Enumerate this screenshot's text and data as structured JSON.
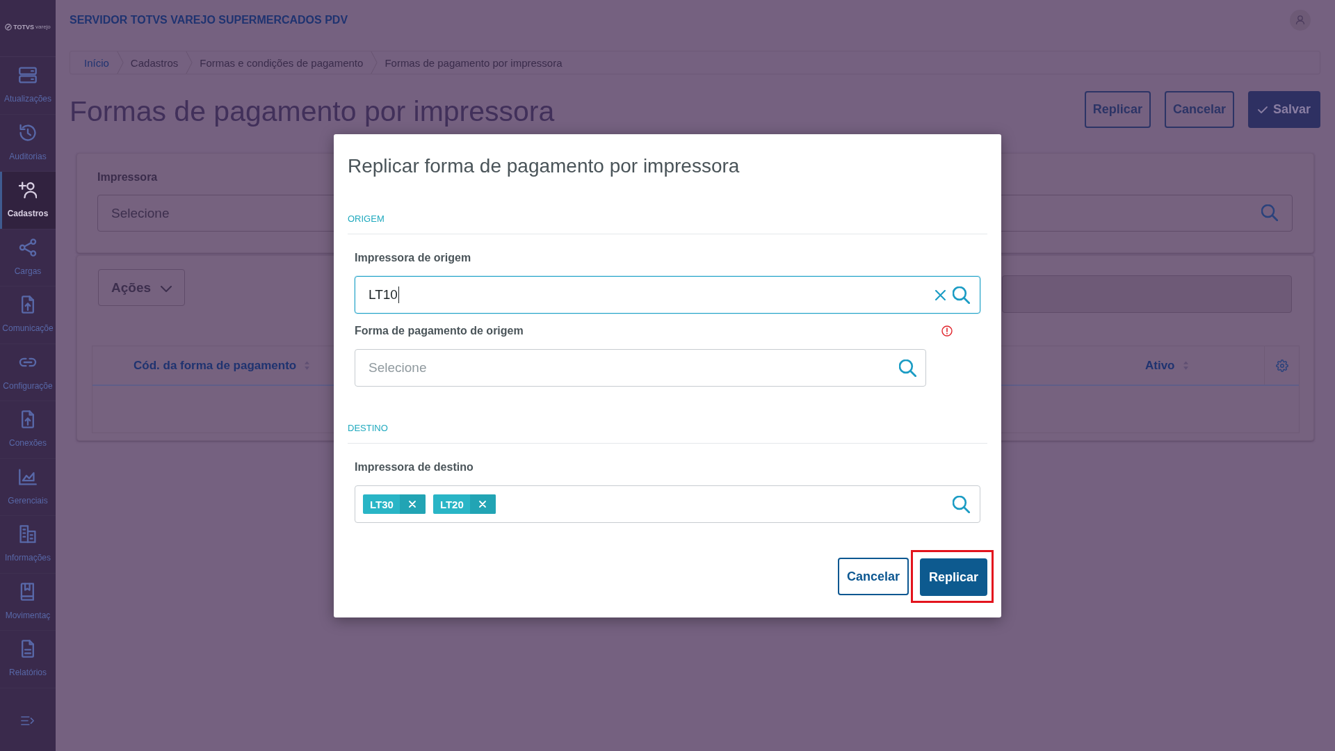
{
  "sidebar": {
    "logo": {
      "brand": "TOTVS",
      "product": "varejo"
    },
    "items": [
      {
        "label": "Atualizações",
        "selected": false
      },
      {
        "label": "Auditorias",
        "selected": false
      },
      {
        "label": "Cadastros",
        "selected": true
      },
      {
        "label": "Cargas",
        "selected": false
      },
      {
        "label": "Comunicaçõe",
        "selected": false
      },
      {
        "label": "Configuraçõe",
        "selected": false
      },
      {
        "label": "Conexões",
        "selected": false
      },
      {
        "label": "Gerenciais",
        "selected": false
      },
      {
        "label": "Informações",
        "selected": false
      },
      {
        "label": "Movimentaç",
        "selected": false
      },
      {
        "label": "Relatórios",
        "selected": false
      }
    ]
  },
  "header": {
    "title": "SERVIDOR TOTVS VAREJO SUPERMERCADOS PDV"
  },
  "breadcrumb": [
    {
      "label": "Início",
      "kind": "link"
    },
    {
      "label": "Cadastros",
      "kind": "text"
    },
    {
      "label": "Formas e condições de pagamento",
      "kind": "text"
    },
    {
      "label": "Formas de pagamento por impressora",
      "kind": "text"
    }
  ],
  "page": {
    "title": "Formas de pagamento por impressora",
    "actions": [
      {
        "label": "Replicar",
        "kind": "outline"
      },
      {
        "label": "Cancelar",
        "kind": "outline"
      },
      {
        "label": "Salvar",
        "kind": "primary"
      }
    ]
  },
  "filter": {
    "label": "Impressora",
    "placeholder": "Selecione"
  },
  "list": {
    "actions_menu": "Ações",
    "table": {
      "columns": [
        {
          "label": "Cód. da forma de pagamento",
          "sortable": true
        },
        {
          "label": "Ativo",
          "sortable": true
        }
      ]
    }
  },
  "modal": {
    "title": "Replicar forma de pagamento por impressora",
    "sections": [
      {
        "heading": "ORIGEM",
        "fields": [
          {
            "label": "Impressora de origem",
            "kind": "lookup",
            "value": "LT10",
            "focused": true,
            "clearable": true,
            "error": false
          },
          {
            "label": "Forma de pagamento de origem",
            "kind": "lookup",
            "placeholder": "Selecione",
            "focused": false,
            "clearable": false,
            "error": true
          }
        ]
      },
      {
        "heading": "DESTINO",
        "fields": [
          {
            "label": "Impressora de destino",
            "kind": "multiselect",
            "chips": [
              "LT30",
              "LT20"
            ],
            "focused": false,
            "clearable": false,
            "error": false
          }
        ]
      }
    ],
    "buttons": [
      {
        "label": "Cancelar",
        "kind": "secondary",
        "highlighted": false
      },
      {
        "label": "Replicar",
        "kind": "primary",
        "highlighted": true
      }
    ]
  }
}
